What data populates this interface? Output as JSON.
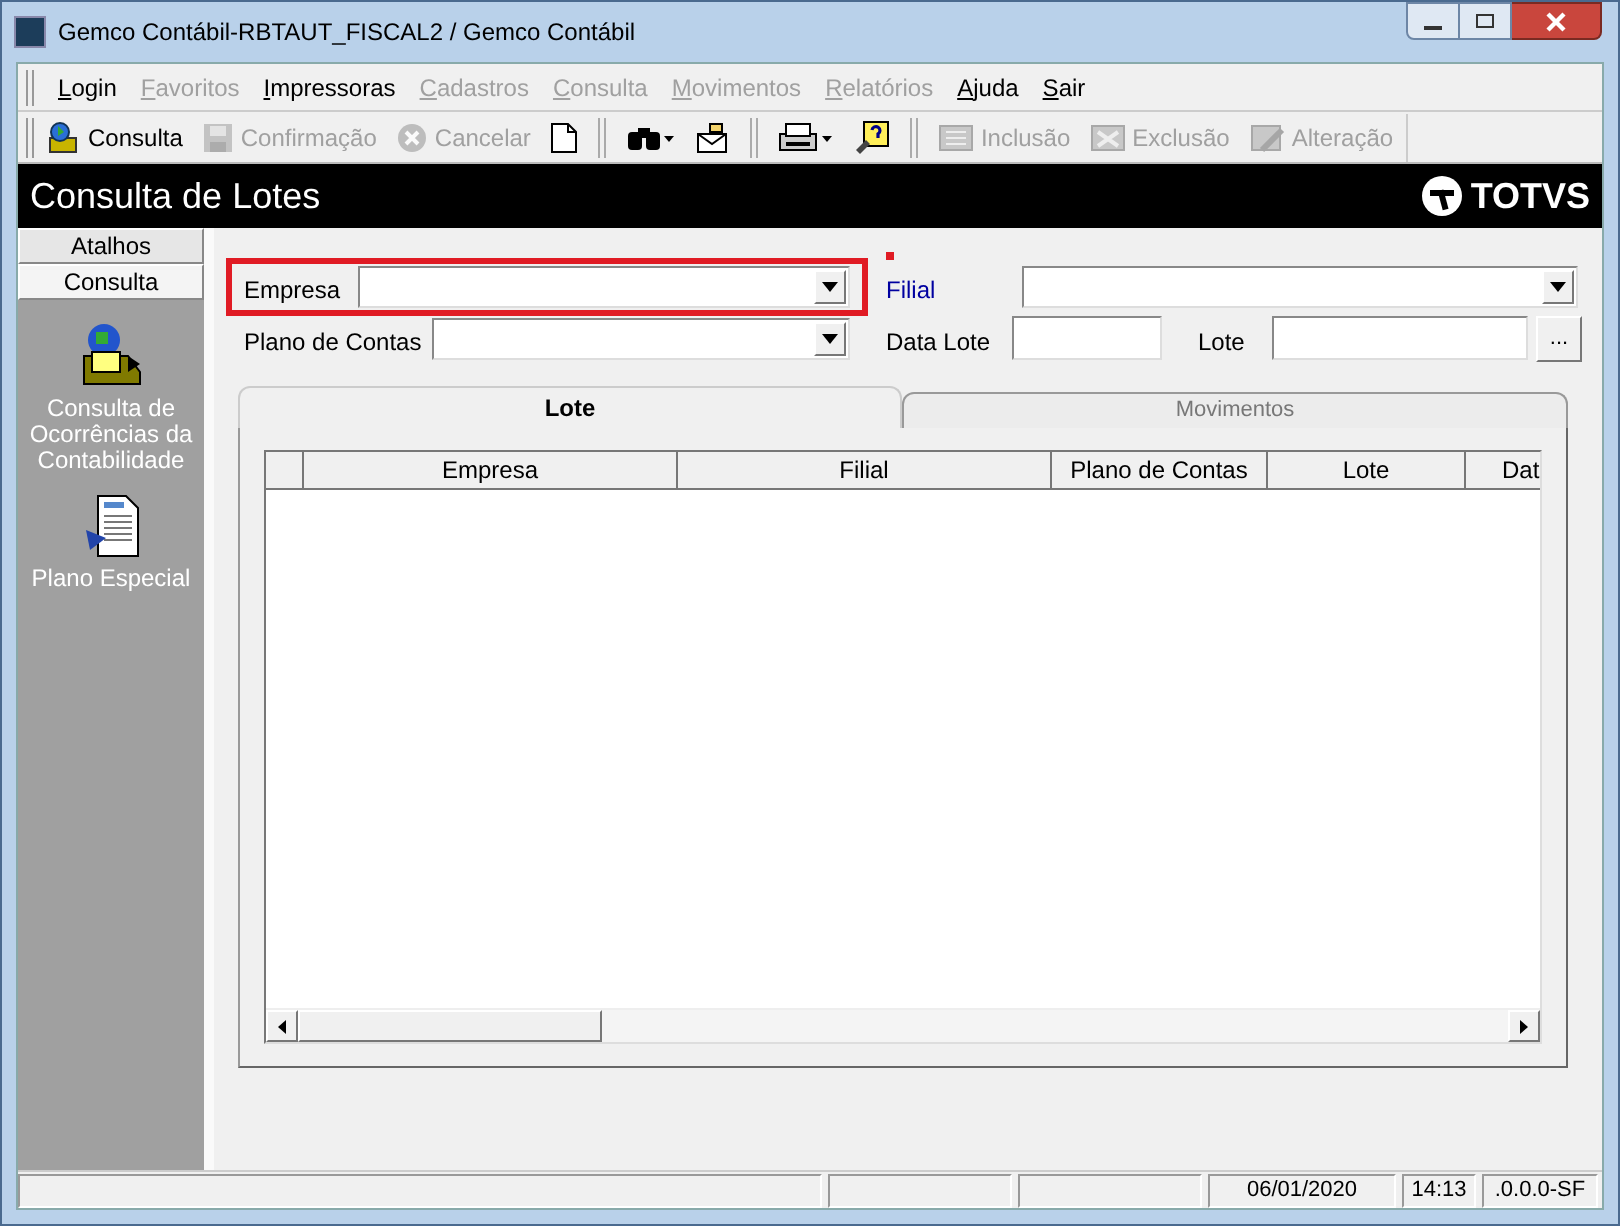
{
  "window": {
    "title": "Gemco Contábil-RBTAUT_FISCAL2 / Gemco Contábil"
  },
  "menu": [
    {
      "label": "Login",
      "disabled": false
    },
    {
      "label": "Favoritos",
      "disabled": true
    },
    {
      "label": "Impressoras",
      "disabled": false
    },
    {
      "label": "Cadastros",
      "disabled": true
    },
    {
      "label": "Consulta",
      "disabled": true
    },
    {
      "label": "Movimentos",
      "disabled": true
    },
    {
      "label": "Relatórios",
      "disabled": true
    },
    {
      "label": "Ajuda",
      "disabled": false
    },
    {
      "label": "Sair",
      "disabled": false
    }
  ],
  "toolbar": [
    {
      "kind": "search",
      "label": "Consulta",
      "disabled": false
    },
    {
      "kind": "save",
      "label": "Confirmação",
      "disabled": true
    },
    {
      "kind": "cancel",
      "label": "Cancelar",
      "disabled": true
    },
    {
      "kind": "new",
      "disabled": false
    },
    {
      "kind": "sep"
    },
    {
      "kind": "binoculars",
      "disabled": false
    },
    {
      "kind": "export",
      "disabled": false
    },
    {
      "kind": "sep"
    },
    {
      "kind": "print",
      "disabled": false
    },
    {
      "kind": "help",
      "disabled": false
    },
    {
      "kind": "sep"
    },
    {
      "kind": "add",
      "label": "Inclusão",
      "disabled": true
    },
    {
      "kind": "delete",
      "label": "Exclusão",
      "disabled": true
    },
    {
      "kind": "edit",
      "label": "Alteração",
      "disabled": true
    }
  ],
  "header": {
    "title": "Consulta de Lotes",
    "logo": "TOTVS"
  },
  "sidebar": {
    "sections": [
      {
        "label": "Atalhos",
        "selected": false
      },
      {
        "label": "Consulta",
        "selected": true
      }
    ],
    "items": [
      {
        "kind": "folder",
        "label": "Consulta de Ocorrências da Contabilidade"
      },
      {
        "kind": "document",
        "label": "Plano Especial"
      }
    ]
  },
  "form": {
    "rows": [
      [
        {
          "label": "Empresa",
          "kind": "combo",
          "highlighted": true,
          "required": false
        },
        {
          "label": "Filial",
          "kind": "combo",
          "highlighted": false,
          "required": true
        }
      ],
      [
        {
          "label": "Plano de Contas",
          "kind": "combo",
          "highlighted": false,
          "required": false
        },
        {
          "label": "Data Lote",
          "kind": "text",
          "highlighted": false,
          "required": false
        },
        {
          "label": "Lote",
          "kind": "lookup",
          "button": "...",
          "highlighted": false,
          "required": false
        }
      ]
    ]
  },
  "tabs": [
    {
      "label": "Lote",
      "selected": true
    },
    {
      "label": "Movimentos",
      "selected": false
    }
  ],
  "table": {
    "columns": [
      "Empresa",
      "Filial",
      "Plano de Contas",
      "Lote",
      "Dat"
    ]
  },
  "status_bar": {
    "date": "06/01/2020",
    "time": "14:13",
    "version": ".0.0.0-SF"
  }
}
